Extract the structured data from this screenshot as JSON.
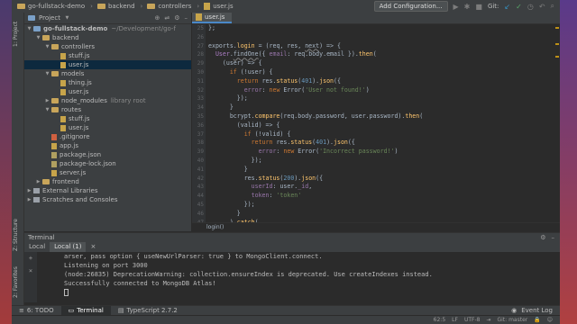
{
  "navbar": {
    "breadcrumbs": [
      "go-fullstack-demo",
      "backend",
      "controllers",
      "user.js"
    ],
    "add_configuration": "Add Configuration...",
    "git_label": "Git:"
  },
  "left_stripe": {
    "project": "1: Project",
    "structure": "Z: Structure",
    "favorites": "2: Favorites"
  },
  "project_panel": {
    "title": "Project",
    "root_name": "go-fullstack-demo",
    "root_path": "~/Development/go-f",
    "tree": [
      {
        "label": "backend"
      },
      {
        "label": "controllers"
      },
      {
        "label": "stuff.js"
      },
      {
        "label": "user.js"
      },
      {
        "label": "models"
      },
      {
        "label": "thing.js"
      },
      {
        "label": "user.js"
      },
      {
        "label": "node_modules"
      },
      {
        "label": "routes"
      },
      {
        "label": "stuff.js"
      },
      {
        "label": "user.js"
      },
      {
        "label": ".gitignore"
      },
      {
        "label": "app.js"
      },
      {
        "label": "package.json"
      },
      {
        "label": "package-lock.json"
      },
      {
        "label": "server.js"
      },
      {
        "label": "frontend"
      },
      {
        "label": "External Libraries"
      },
      {
        "label": "Scratches and Consoles"
      }
    ],
    "library_root_hint": "library root"
  },
  "editor": {
    "tab": "user.js",
    "line_numbers": [
      "25",
      "26",
      "27",
      "28",
      "29",
      "30",
      "31",
      "32",
      "33",
      "34",
      "35",
      "36",
      "37",
      "38",
      "39",
      "40",
      "41",
      "42",
      "43",
      "44",
      "45",
      "46",
      "47",
      "48",
      "49"
    ],
    "breadcrumb": "login()"
  },
  "terminal": {
    "title": "Terminal",
    "tabs": [
      "Local",
      "Local (1)"
    ],
    "lines": [
      "arser, pass option { useNewUrlParser: true } to MongoClient.connect.",
      "Listening on port 3000",
      "(node:26835) DeprecationWarning: collection.ensureIndex is deprecated. Use createIndexes instead.",
      "Successfully connected to MongoDB Atlas!"
    ]
  },
  "bottom_tabs": {
    "todo": "6: TODO",
    "terminal": "Terminal",
    "typescript": "TypeScript 2.7.2",
    "event_log": "Event Log"
  },
  "status": {
    "position": "62:5",
    "line_sep": "LF",
    "encoding": "UTF-8",
    "git_branch": "Git: master"
  }
}
